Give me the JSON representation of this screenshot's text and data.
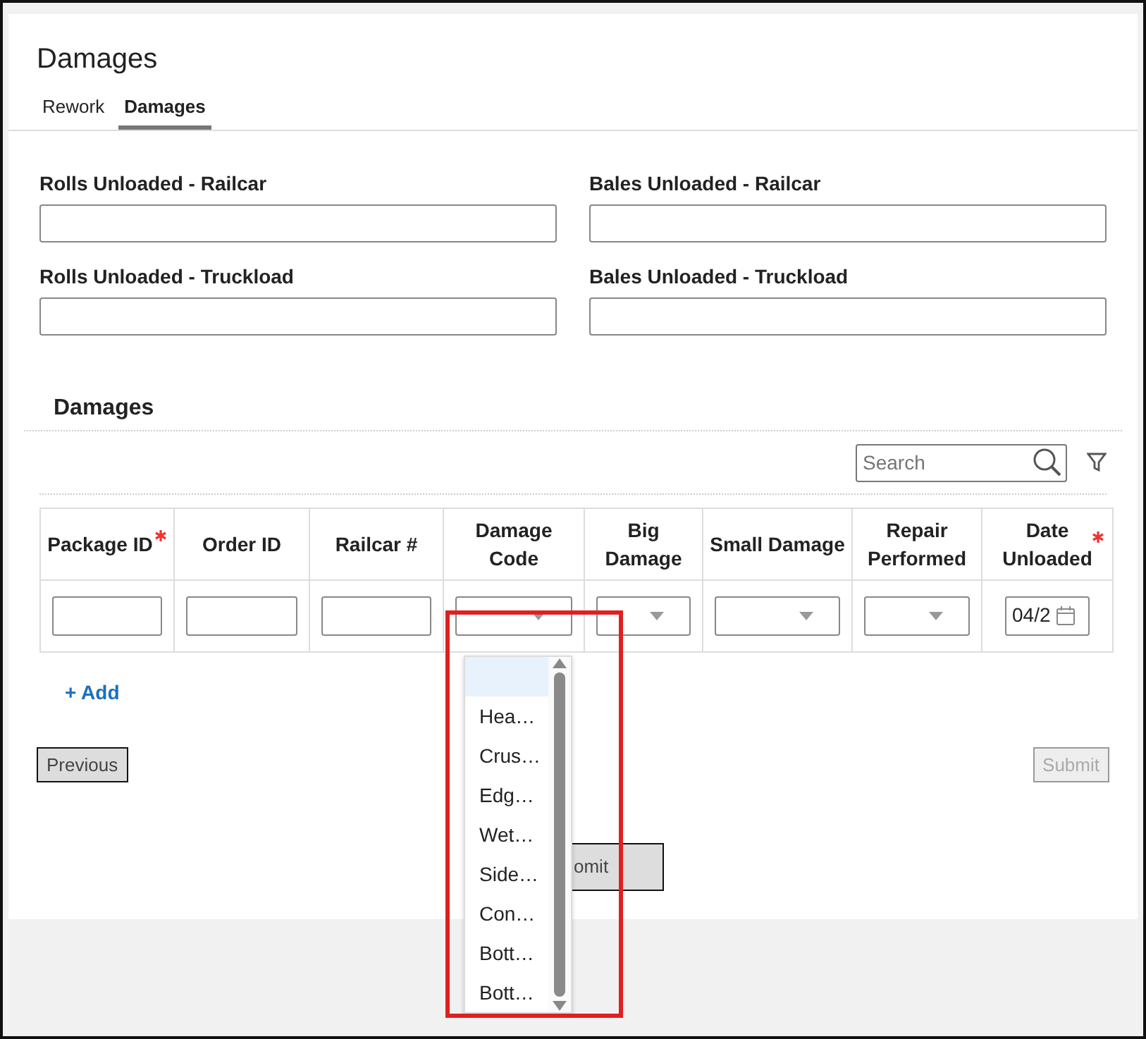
{
  "page": {
    "title": "Damages"
  },
  "tabs": [
    {
      "label": "Rework",
      "selected": false
    },
    {
      "label": "Damages",
      "selected": true
    }
  ],
  "fields": [
    {
      "label": "Rolls Unloaded - Railcar"
    },
    {
      "label": "Bales Unloaded - Railcar"
    },
    {
      "label": "Rolls Unloaded - Truckload"
    },
    {
      "label": "Bales Unloaded - Truckload"
    }
  ],
  "section": {
    "title": "Damages",
    "search": {
      "placeholder": "Search"
    }
  },
  "table": {
    "columns": [
      {
        "label": "Package ID",
        "required": true
      },
      {
        "label": "Order ID",
        "required": false
      },
      {
        "label": "Railcar #",
        "required": false
      },
      {
        "label": "Damage Code",
        "required": false
      },
      {
        "label": "Big Damage",
        "required": false
      },
      {
        "label": "Small Damage",
        "required": false
      },
      {
        "label": "Repair Performed",
        "required": false
      },
      {
        "label": "Date Unloaded",
        "required": true
      }
    ],
    "rows": [
      {
        "cells": [
          {
            "kind": "text"
          },
          {
            "kind": "text"
          },
          {
            "kind": "text"
          },
          {
            "kind": "select",
            "options": [
              {
                "highlighted": true
              },
              {
                "label": "Hea…",
                "highlighted": false
              },
              {
                "label": "Crus…",
                "highlighted": false
              },
              {
                "label": "Edg…",
                "highlighted": false
              },
              {
                "label": "Wet…",
                "highlighted": false
              },
              {
                "label": "Side…",
                "highlighted": false
              },
              {
                "label": "Con…",
                "highlighted": false
              },
              {
                "label": "Bott…",
                "highlighted": false
              },
              {
                "label": "Bott…",
                "highlighted": false
              }
            ]
          },
          {
            "kind": "select"
          },
          {
            "kind": "select"
          },
          {
            "kind": "select"
          },
          {
            "kind": "date",
            "value": "04/2"
          }
        ]
      }
    ]
  },
  "add_link": "+ Add",
  "buttons": [
    {
      "label": "Previous",
      "disabled": false
    },
    {
      "label": "Submit",
      "disabled": true
    }
  ],
  "covered_button": {
    "label": "omit"
  }
}
